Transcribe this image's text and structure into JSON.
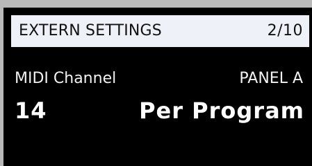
{
  "header": {
    "title": "EXTERN SETTINGS",
    "page_indicator": "2/10"
  },
  "parameter": {
    "name": "MIDI Channel",
    "panel": "PANEL A",
    "value": "14",
    "mode": "Per Program"
  },
  "colors": {
    "bezel": "#b9b9b9",
    "screen": "#000000",
    "header_bg": "#eef1f7",
    "header_text": "#111111",
    "text": "#ffffff"
  }
}
